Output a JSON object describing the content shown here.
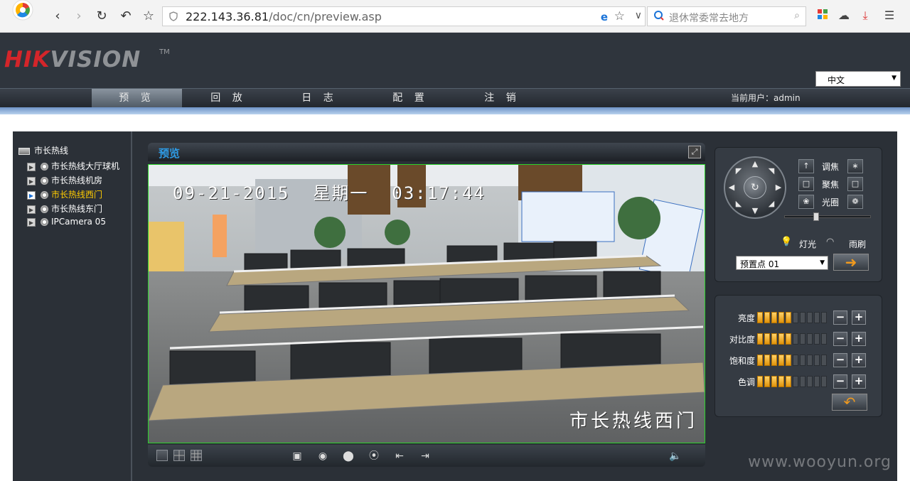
{
  "browser": {
    "url_host": "222.143.36.81",
    "url_path": "/doc/cn/preview.asp",
    "search_placeholder": "退休常委常去地方"
  },
  "header": {
    "logo_red": "HIK",
    "logo_gray": "VISION",
    "logo_tm": "TM",
    "language": "中文"
  },
  "menu": {
    "items": [
      "预 览",
      "回 放",
      "日 志",
      "配 置",
      "注 销"
    ],
    "current_user": "当前用户：admin"
  },
  "tree": {
    "root": "市长热线",
    "items": [
      {
        "label": "市长热线大厅球机",
        "selected": false
      },
      {
        "label": "市长热线机房",
        "selected": false
      },
      {
        "label": "市长热线西门",
        "selected": true
      },
      {
        "label": "市长热线东门",
        "selected": false
      },
      {
        "label": "IPCamera 05",
        "selected": false
      }
    ]
  },
  "video": {
    "title": "预览",
    "osd_time": "09-21-2015  星期一  03:17:44",
    "osd_name": "市长热线西门"
  },
  "ptz": {
    "labels": {
      "zoom": "调焦",
      "focus": "聚焦",
      "iris": "光圈",
      "light": "灯光",
      "wiper": "雨刷"
    },
    "preset": "预置点 01"
  },
  "adjust": {
    "rows": [
      {
        "label": "亮度",
        "level": 5,
        "max": 10
      },
      {
        "label": "对比度",
        "level": 5,
        "max": 10
      },
      {
        "label": "饱和度",
        "level": 5,
        "max": 10
      },
      {
        "label": "色调",
        "level": 5,
        "max": 10
      }
    ]
  },
  "watermark": "www.wooyun.org",
  "colors": {
    "accent_blue": "#2e9be5",
    "highlight_yellow": "#ffcc00",
    "brand_red": "#d4252a",
    "bar_orange": "#e0930a"
  }
}
